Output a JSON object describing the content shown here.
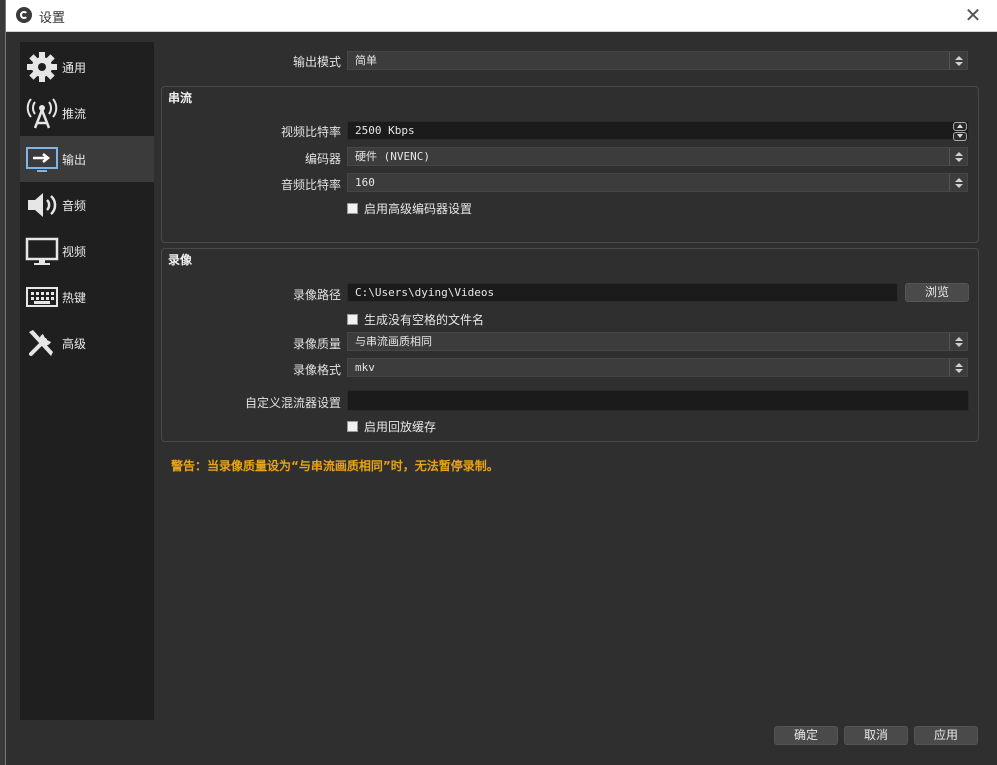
{
  "window": {
    "title": "设置",
    "close_glyph": "✕"
  },
  "sidebar": {
    "items": [
      {
        "label": "通用",
        "icon": "gear-icon"
      },
      {
        "label": "推流",
        "icon": "antenna-icon"
      },
      {
        "label": "输出",
        "icon": "monitor-output-icon",
        "active": true
      },
      {
        "label": "音频",
        "icon": "speaker-icon"
      },
      {
        "label": "视频",
        "icon": "display-icon"
      },
      {
        "label": "热键",
        "icon": "keyboard-icon"
      },
      {
        "label": "高级",
        "icon": "tools-icon"
      }
    ]
  },
  "output_mode": {
    "label": "输出模式",
    "value": "简单"
  },
  "streaming": {
    "title": "串流",
    "video_bitrate": {
      "label": "视频比特率",
      "value": "2500 Kbps"
    },
    "encoder": {
      "label": "编码器",
      "value": "硬件 (NVENC)"
    },
    "audio_bitrate": {
      "label": "音频比特率",
      "value": "160"
    },
    "advanced_encoder_checkbox": {
      "label": "启用高级编码器设置",
      "checked": false
    }
  },
  "recording": {
    "title": "录像",
    "path": {
      "label": "录像路径",
      "value": "C:\\Users\\dying\\Videos",
      "browse_label": "浏览"
    },
    "no_space_checkbox": {
      "label": "生成没有空格的文件名",
      "checked": false
    },
    "quality": {
      "label": "录像质量",
      "value": "与串流画质相同"
    },
    "format": {
      "label": "录像格式",
      "value": "mkv"
    },
    "custom_muxer": {
      "label": "自定义混流器设置",
      "value": ""
    },
    "replay_buffer_checkbox": {
      "label": "启用回放缓存",
      "checked": false
    }
  },
  "warning": "警告：当录像质量设为“与串流画质相同”时，无法暂停录制。",
  "footer": {
    "ok_label": "确定",
    "cancel_label": "取消",
    "apply_label": "应用"
  },
  "colors": {
    "accent_warning": "#e8a317",
    "active_sidebar_bg": "#3b3b3b"
  }
}
